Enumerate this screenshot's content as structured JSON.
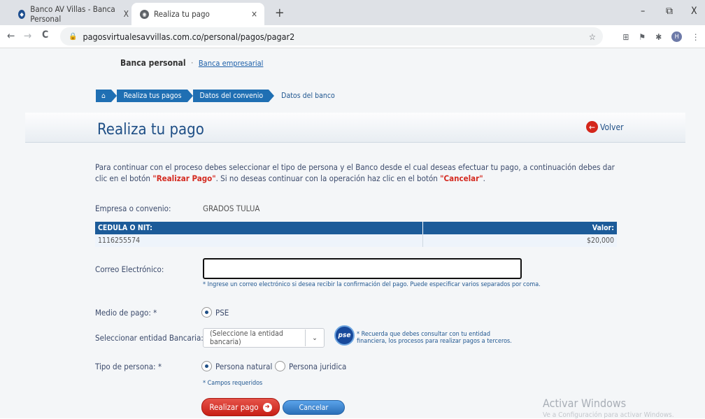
{
  "browser": {
    "tabs": [
      {
        "label": "Banco AV Villas - Banca Personal",
        "close": "X"
      },
      {
        "label": "Realiza tu pago",
        "close": "×"
      }
    ],
    "new_tab": "+",
    "window_controls": {
      "minimize": "–",
      "restore": "⧉",
      "close": "X"
    },
    "nav": {
      "back": "←",
      "forward": "→",
      "reload": "C"
    },
    "url": "pagosvirtualesavvillas.com.co/personal/pagos/pagar2",
    "profile_initial": "H"
  },
  "header": {
    "banca_personal": "Banca personal",
    "separator": "·",
    "banca_empresarial": "Banca empresarial"
  },
  "breadcrumb": [
    "Realiza tus pagos",
    "Datos del convenio",
    "Datos del banco"
  ],
  "page": {
    "title": "Realiza tu pago",
    "volver": "Volver",
    "intro_1": "Para continuar con el proceso debes seleccionar el tipo de persona y el Banco desde el cual deseas efectuar tu pago, a continuación debes dar clic en el botón",
    "intro_realizar": "\"Realizar Pago\"",
    "intro_2": ". Si no deseas continuar con la operación haz clic en el botón ",
    "intro_cancelar": "\"Cancelar\"",
    "intro_end": "."
  },
  "form": {
    "empresa_label": "Empresa o convenio:",
    "empresa_value": "GRADOS TULUA",
    "table": {
      "headers": [
        "CEDULA O NIT:",
        "Valor:"
      ],
      "row": [
        "1116255574",
        "$20,000"
      ]
    },
    "email_label": "Correo Electrónico:",
    "email_value": "",
    "email_hint": "* Ingrese un correo electrónico si desea recibir la confirmación del pago. Puede especificar varios separados por coma.",
    "medio_label": "Medio de pago: *",
    "medio_option": "PSE",
    "banco_label": "Seleccionar entidad Bancaria: *",
    "banco_placeholder": "(Seleccione la entidad bancaria)",
    "pse_logo": "pse",
    "pse_note_1": "* Recuerda que debes consultar con tu entidad",
    "pse_note_2": "financiera,   los procesos para realizar pagos a terceros.",
    "tipo_label": "Tipo de persona: *",
    "tipo_options": [
      "Persona natural",
      "Persona juridica"
    ],
    "required_note": "* Campos requeridos",
    "pay_button": "Realizar pago",
    "cancel_button": "Cancelar"
  },
  "watermark": {
    "title": "Activar Windows",
    "subtitle": "Ve a Configuración para activar Windows."
  }
}
